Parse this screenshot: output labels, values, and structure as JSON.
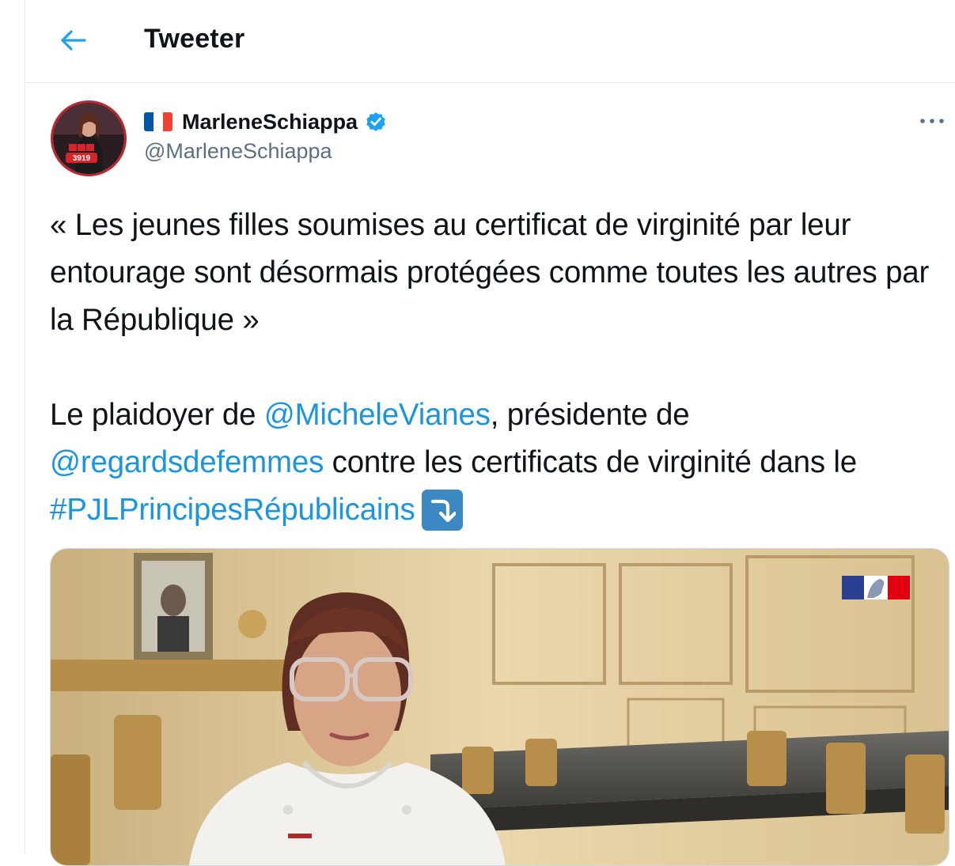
{
  "header": {
    "title": "Tweeter"
  },
  "author": {
    "display_name": "MarleneSchiappa",
    "handle": "@MarleneSchiappa",
    "verified": true,
    "flag": "France",
    "avatar_badge": "3919"
  },
  "tweet": {
    "paragraph1": "« Les jeunes filles soumises au certificat de virginité par leur entourage sont désormais protégées comme toutes les autres par la République »",
    "p2_part1": "Le plaidoyer de ",
    "mention1": "@MicheleVianes",
    "p2_part2": ", présidente de ",
    "mention2": "@regardsdefemmes",
    "p2_part3": " contre les certificats de virginité dans le ",
    "hashtag": "#PJLPrincipesRépublicains",
    "emoji": "⤵️"
  },
  "icons": {
    "back": "arrow-left-icon",
    "verified": "verified-badge-icon",
    "more": "more-dots-icon",
    "emoji": "arrow-curving-down-icon"
  },
  "colors": {
    "link": "#1b95e0",
    "secondary_text": "#5b7083",
    "border": "#e6ecf0",
    "verified": "#1da1f2"
  }
}
